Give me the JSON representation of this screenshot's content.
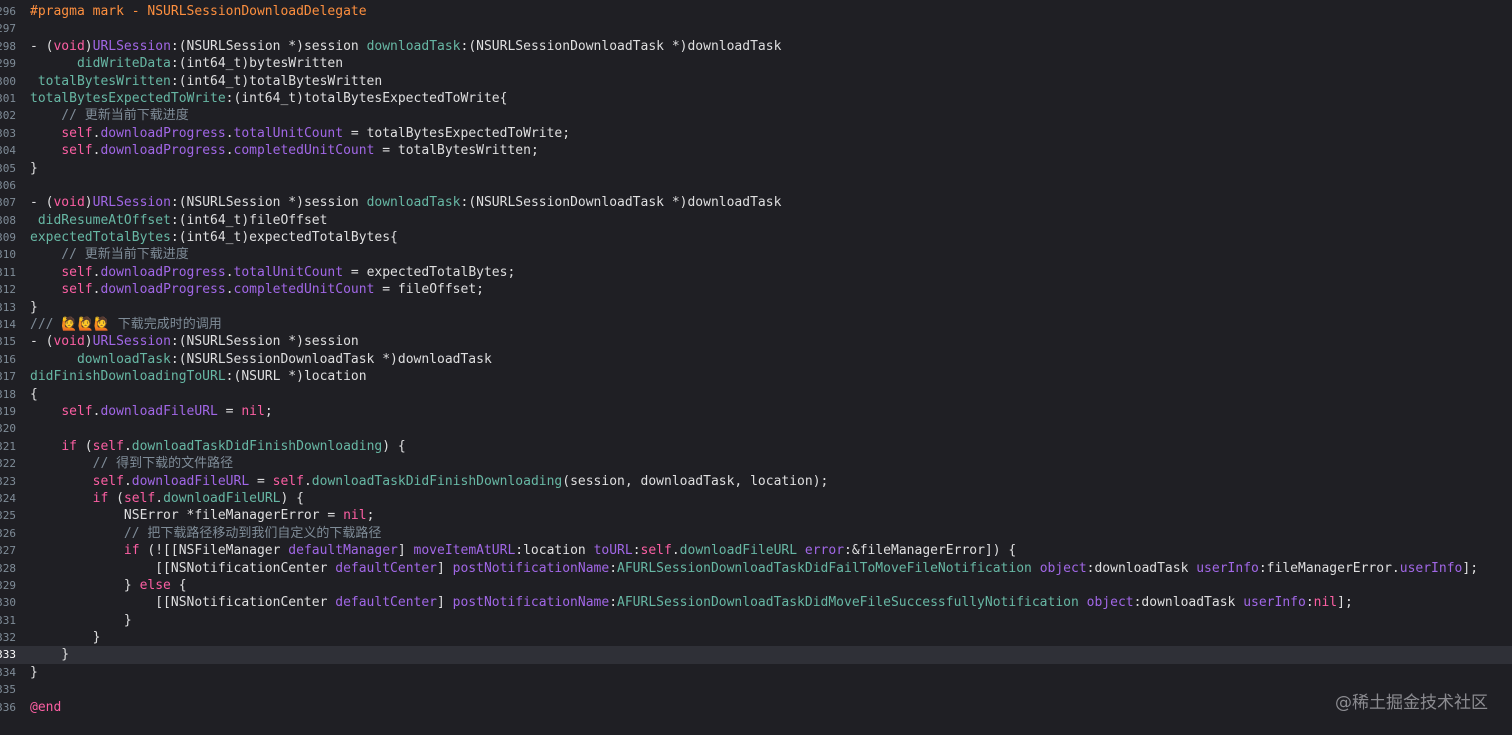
{
  "editor": {
    "current_line": 333,
    "lines": [
      {
        "n": 296,
        "tokens": [
          {
            "t": "#pragma mark - NSURLSessionDownloadDelegate",
            "c": "pragma"
          }
        ]
      },
      {
        "n": 297,
        "tokens": []
      },
      {
        "n": 298,
        "tokens": [
          {
            "t": "- (",
            "c": "plain"
          },
          {
            "t": "void",
            "c": "kw"
          },
          {
            "t": ")",
            "c": "plain"
          },
          {
            "t": "URLSession",
            "c": "method"
          },
          {
            "t": ":(NSURLSession *)session ",
            "c": "plain"
          },
          {
            "t": "downloadTask",
            "c": "param"
          },
          {
            "t": ":(NSURLSessionDownloadTask *)downloadTask",
            "c": "plain"
          }
        ]
      },
      {
        "n": 299,
        "tokens": [
          {
            "t": "      ",
            "c": "plain"
          },
          {
            "t": "didWriteData",
            "c": "param"
          },
          {
            "t": ":(int64_t)bytesWritten",
            "c": "plain"
          }
        ]
      },
      {
        "n": 300,
        "tokens": [
          {
            "t": " ",
            "c": "plain"
          },
          {
            "t": "totalBytesWritten",
            "c": "param"
          },
          {
            "t": ":(int64_t)totalBytesWritten",
            "c": "plain"
          }
        ]
      },
      {
        "n": 301,
        "tokens": [
          {
            "t": "totalBytesExpectedToWrite",
            "c": "param"
          },
          {
            "t": ":(int64_t)totalBytesExpectedToWrite{",
            "c": "plain"
          }
        ]
      },
      {
        "n": 302,
        "tokens": [
          {
            "t": "    // 更新当前下载进度",
            "c": "comment"
          }
        ]
      },
      {
        "n": 303,
        "tokens": [
          {
            "t": "    ",
            "c": "plain"
          },
          {
            "t": "self",
            "c": "self"
          },
          {
            "t": ".",
            "c": "plain"
          },
          {
            "t": "downloadProgress",
            "c": "prop"
          },
          {
            "t": ".",
            "c": "plain"
          },
          {
            "t": "totalUnitCount",
            "c": "prop"
          },
          {
            "t": " = totalBytesExpectedToWrite;",
            "c": "plain"
          }
        ]
      },
      {
        "n": 304,
        "tokens": [
          {
            "t": "    ",
            "c": "plain"
          },
          {
            "t": "self",
            "c": "self"
          },
          {
            "t": ".",
            "c": "plain"
          },
          {
            "t": "downloadProgress",
            "c": "prop"
          },
          {
            "t": ".",
            "c": "plain"
          },
          {
            "t": "completedUnitCount",
            "c": "prop"
          },
          {
            "t": " = totalBytesWritten;",
            "c": "plain"
          }
        ]
      },
      {
        "n": 305,
        "tokens": [
          {
            "t": "}",
            "c": "plain"
          }
        ]
      },
      {
        "n": 306,
        "tokens": []
      },
      {
        "n": 307,
        "tokens": [
          {
            "t": "- (",
            "c": "plain"
          },
          {
            "t": "void",
            "c": "kw"
          },
          {
            "t": ")",
            "c": "plain"
          },
          {
            "t": "URLSession",
            "c": "method"
          },
          {
            "t": ":(NSURLSession *)session ",
            "c": "plain"
          },
          {
            "t": "downloadTask",
            "c": "param"
          },
          {
            "t": ":(NSURLSessionDownloadTask *)downloadTask",
            "c": "plain"
          }
        ]
      },
      {
        "n": 308,
        "tokens": [
          {
            "t": " ",
            "c": "plain"
          },
          {
            "t": "didResumeAtOffset",
            "c": "param"
          },
          {
            "t": ":(int64_t)fileOffset",
            "c": "plain"
          }
        ]
      },
      {
        "n": 309,
        "tokens": [
          {
            "t": "expectedTotalBytes",
            "c": "param"
          },
          {
            "t": ":(int64_t)expectedTotalBytes{",
            "c": "plain"
          }
        ]
      },
      {
        "n": 310,
        "tokens": [
          {
            "t": "    // 更新当前下载进度",
            "c": "comment"
          }
        ]
      },
      {
        "n": 311,
        "tokens": [
          {
            "t": "    ",
            "c": "plain"
          },
          {
            "t": "self",
            "c": "self"
          },
          {
            "t": ".",
            "c": "plain"
          },
          {
            "t": "downloadProgress",
            "c": "prop"
          },
          {
            "t": ".",
            "c": "plain"
          },
          {
            "t": "totalUnitCount",
            "c": "prop"
          },
          {
            "t": " = expectedTotalBytes;",
            "c": "plain"
          }
        ]
      },
      {
        "n": 312,
        "tokens": [
          {
            "t": "    ",
            "c": "plain"
          },
          {
            "t": "self",
            "c": "self"
          },
          {
            "t": ".",
            "c": "plain"
          },
          {
            "t": "downloadProgress",
            "c": "prop"
          },
          {
            "t": ".",
            "c": "plain"
          },
          {
            "t": "completedUnitCount",
            "c": "prop"
          },
          {
            "t": " = fileOffset;",
            "c": "plain"
          }
        ]
      },
      {
        "n": 313,
        "tokens": [
          {
            "t": "}",
            "c": "plain"
          }
        ]
      },
      {
        "n": 314,
        "tokens": [
          {
            "t": "/// ",
            "c": "comment"
          },
          {
            "t": "🙋🙋🙋",
            "c": "emoji"
          },
          {
            "t": " 下载完成时的调用",
            "c": "comment"
          }
        ]
      },
      {
        "n": 315,
        "tokens": [
          {
            "t": "- (",
            "c": "plain"
          },
          {
            "t": "void",
            "c": "kw"
          },
          {
            "t": ")",
            "c": "plain"
          },
          {
            "t": "URLSession",
            "c": "method"
          },
          {
            "t": ":(NSURLSession *)session",
            "c": "plain"
          }
        ]
      },
      {
        "n": 316,
        "tokens": [
          {
            "t": "      ",
            "c": "plain"
          },
          {
            "t": "downloadTask",
            "c": "param"
          },
          {
            "t": ":(NSURLSessionDownloadTask *)downloadTask",
            "c": "plain"
          }
        ]
      },
      {
        "n": 317,
        "tokens": [
          {
            "t": "didFinishDownloadingToURL",
            "c": "param"
          },
          {
            "t": ":(NSURL *)location",
            "c": "plain"
          }
        ]
      },
      {
        "n": 318,
        "tokens": [
          {
            "t": "{",
            "c": "plain"
          }
        ]
      },
      {
        "n": 319,
        "tokens": [
          {
            "t": "    ",
            "c": "plain"
          },
          {
            "t": "self",
            "c": "self"
          },
          {
            "t": ".",
            "c": "plain"
          },
          {
            "t": "downloadFileURL",
            "c": "prop"
          },
          {
            "t": " = ",
            "c": "plain"
          },
          {
            "t": "nil",
            "c": "kw"
          },
          {
            "t": ";",
            "c": "plain"
          }
        ]
      },
      {
        "n": 320,
        "tokens": []
      },
      {
        "n": 321,
        "tokens": [
          {
            "t": "    ",
            "c": "plain"
          },
          {
            "t": "if",
            "c": "kw"
          },
          {
            "t": " (",
            "c": "plain"
          },
          {
            "t": "self",
            "c": "self"
          },
          {
            "t": ".",
            "c": "plain"
          },
          {
            "t": "downloadTaskDidFinishDownloading",
            "c": "param"
          },
          {
            "t": ") {",
            "c": "plain"
          }
        ]
      },
      {
        "n": 322,
        "tokens": [
          {
            "t": "        // 得到下载的文件路径",
            "c": "comment"
          }
        ]
      },
      {
        "n": 323,
        "tokens": [
          {
            "t": "        ",
            "c": "plain"
          },
          {
            "t": "self",
            "c": "self"
          },
          {
            "t": ".",
            "c": "plain"
          },
          {
            "t": "downloadFileURL",
            "c": "prop"
          },
          {
            "t": " = ",
            "c": "plain"
          },
          {
            "t": "self",
            "c": "self"
          },
          {
            "t": ".",
            "c": "plain"
          },
          {
            "t": "downloadTaskDidFinishDownloading",
            "c": "param"
          },
          {
            "t": "(session, downloadTask, location);",
            "c": "plain"
          }
        ]
      },
      {
        "n": 324,
        "tokens": [
          {
            "t": "        ",
            "c": "plain"
          },
          {
            "t": "if",
            "c": "kw"
          },
          {
            "t": " (",
            "c": "plain"
          },
          {
            "t": "self",
            "c": "self"
          },
          {
            "t": ".",
            "c": "plain"
          },
          {
            "t": "downloadFileURL",
            "c": "param"
          },
          {
            "t": ") {",
            "c": "plain"
          }
        ]
      },
      {
        "n": 325,
        "tokens": [
          {
            "t": "            NSError *fileManagerError = ",
            "c": "plain"
          },
          {
            "t": "nil",
            "c": "kw"
          },
          {
            "t": ";",
            "c": "plain"
          }
        ]
      },
      {
        "n": 326,
        "tokens": [
          {
            "t": "            // 把下载路径移动到我们自定义的下载路径",
            "c": "comment"
          }
        ]
      },
      {
        "n": 327,
        "tokens": [
          {
            "t": "            ",
            "c": "plain"
          },
          {
            "t": "if",
            "c": "kw"
          },
          {
            "t": " (![[NSFileManager ",
            "c": "plain"
          },
          {
            "t": "defaultManager",
            "c": "method"
          },
          {
            "t": "] ",
            "c": "plain"
          },
          {
            "t": "moveItemAtURL",
            "c": "method"
          },
          {
            "t": ":location ",
            "c": "plain"
          },
          {
            "t": "toURL",
            "c": "method"
          },
          {
            "t": ":",
            "c": "plain"
          },
          {
            "t": "self",
            "c": "self"
          },
          {
            "t": ".",
            "c": "plain"
          },
          {
            "t": "downloadFileURL",
            "c": "param"
          },
          {
            "t": " ",
            "c": "plain"
          },
          {
            "t": "error",
            "c": "method"
          },
          {
            "t": ":&fileManagerError]) {",
            "c": "plain"
          }
        ]
      },
      {
        "n": 328,
        "tokens": [
          {
            "t": "                [[NSNotificationCenter ",
            "c": "plain"
          },
          {
            "t": "defaultCenter",
            "c": "method"
          },
          {
            "t": "] ",
            "c": "plain"
          },
          {
            "t": "postNotificationName",
            "c": "method"
          },
          {
            "t": ":",
            "c": "plain"
          },
          {
            "t": "AFURLSessionDownloadTaskDidFailToMoveFileNotification",
            "c": "constant"
          },
          {
            "t": " ",
            "c": "plain"
          },
          {
            "t": "object",
            "c": "method"
          },
          {
            "t": ":downloadTask ",
            "c": "plain"
          },
          {
            "t": "userInfo",
            "c": "method"
          },
          {
            "t": ":fileManagerError.",
            "c": "plain"
          },
          {
            "t": "userInfo",
            "c": "prop"
          },
          {
            "t": "];",
            "c": "plain"
          }
        ]
      },
      {
        "n": 329,
        "tokens": [
          {
            "t": "            } ",
            "c": "plain"
          },
          {
            "t": "else",
            "c": "kw"
          },
          {
            "t": " {",
            "c": "plain"
          }
        ]
      },
      {
        "n": 330,
        "tokens": [
          {
            "t": "                [[NSNotificationCenter ",
            "c": "plain"
          },
          {
            "t": "defaultCenter",
            "c": "method"
          },
          {
            "t": "] ",
            "c": "plain"
          },
          {
            "t": "postNotificationName",
            "c": "method"
          },
          {
            "t": ":",
            "c": "plain"
          },
          {
            "t": "AFURLSessionDownloadTaskDidMoveFileSuccessfullyNotification",
            "c": "constant"
          },
          {
            "t": " ",
            "c": "plain"
          },
          {
            "t": "object",
            "c": "method"
          },
          {
            "t": ":downloadTask ",
            "c": "plain"
          },
          {
            "t": "userInfo",
            "c": "method"
          },
          {
            "t": ":",
            "c": "plain"
          },
          {
            "t": "nil",
            "c": "kw"
          },
          {
            "t": "];",
            "c": "plain"
          }
        ]
      },
      {
        "n": 331,
        "tokens": [
          {
            "t": "            }",
            "c": "plain"
          }
        ]
      },
      {
        "n": 332,
        "tokens": [
          {
            "t": "        }",
            "c": "plain"
          }
        ]
      },
      {
        "n": 333,
        "tokens": [
          {
            "t": "    }",
            "c": "plain"
          }
        ]
      },
      {
        "n": 334,
        "tokens": [
          {
            "t": "}",
            "c": "plain"
          }
        ]
      },
      {
        "n": 335,
        "tokens": []
      },
      {
        "n": 336,
        "tokens": [
          {
            "t": "@end",
            "c": "kw"
          }
        ]
      }
    ]
  },
  "watermark": {
    "text": "@稀土掘金技术社区"
  }
}
